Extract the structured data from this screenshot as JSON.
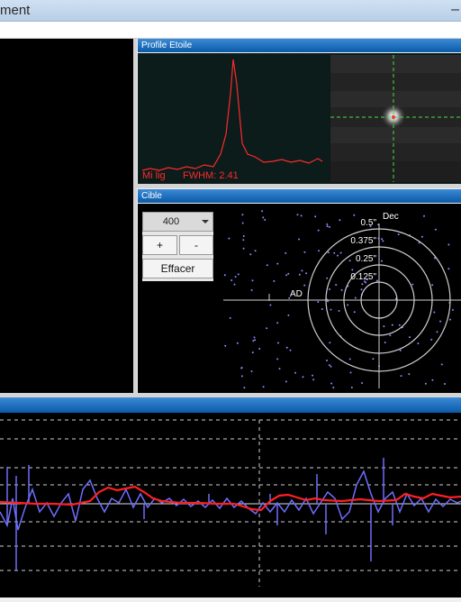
{
  "window": {
    "title": "ment",
    "minimize_glyph": "–"
  },
  "profile_panel": {
    "header": "Profile Etoile",
    "label_mode": "Mi lig",
    "label_fwhm": "FWHM: 2.41"
  },
  "target_panel": {
    "header": "Cible",
    "combo_value": "400",
    "plus_label": "+",
    "minus_label": "-",
    "clear_label": "Effacer",
    "axis_ad": "AD",
    "axis_dec": "Dec",
    "ring_labels": [
      "0.5\"",
      "0.375\"",
      "0.25\"",
      "0.125\""
    ]
  },
  "colors": {
    "panel_header": "#0b5aa8",
    "profile_line": "#ff2a2a",
    "ra_trace": "#6e6eff",
    "dec_trace": "#ff2020",
    "target_rings": "#cfcfcf"
  },
  "icons": [
    "chevron-down-icon",
    "minimize-icon"
  ]
}
